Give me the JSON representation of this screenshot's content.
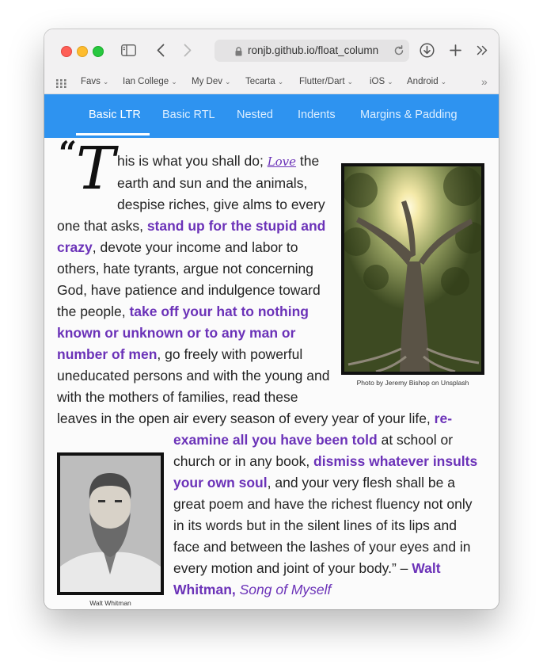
{
  "browser": {
    "url": "ronjb.github.io/float_column",
    "bookmarks": [
      {
        "label": "Favs"
      },
      {
        "label": "Ian College"
      },
      {
        "label": "My Dev"
      },
      {
        "label": "Tecarta"
      },
      {
        "label": "Flutter/Dart"
      },
      {
        "label": "iOS"
      },
      {
        "label": "Android"
      }
    ],
    "icons": [
      "sidebar-icon",
      "chevron-left-icon",
      "chevron-right-icon",
      "lock-icon",
      "reload-icon",
      "download-icon",
      "plus-icon",
      "double-chevron-icon",
      "grid-icon"
    ]
  },
  "nav": {
    "tabs": [
      {
        "label": "Basic LTR",
        "active": true
      },
      {
        "label": "Basic RTL"
      },
      {
        "label": "Nested"
      },
      {
        "label": "Indents"
      },
      {
        "label": "Margins & Padding"
      }
    ],
    "accent": "#2e93f0"
  },
  "article": {
    "open_quote": "“",
    "drop_cap": "T",
    "t1": "his is what you shall do; ",
    "love": "Love",
    "t2": " the earth and sun and the animals, despise riches, give alms to every one that asks, ",
    "h1": "stand up for the stupid and crazy",
    "t3": ", devote your income and labor to others, hate tyrants, argue not concerning God, have patience and indulgence toward the people, ",
    "h2": "take off your hat to nothing known or unknown or to any man or number of men",
    "t4": ", go freely with powerful uneducated persons and with the young and with the mothers of families, read these leaves in the open air every season of every year of your life, ",
    "h3": "re-examine all you have been told",
    "t5": " at school or church or in any book, ",
    "h4": "dismiss whatever insults your own soul",
    "t6": ", and your very flesh shall be a great poem and have the richest fluency not only in its words but in the silent lines of its lips and face and between the lashes of your eyes and in every motion and joint of your body.” – ",
    "cite_author": "Walt Whitman,",
    "cite_work": "Song of Myself",
    "link_color": "#6b32b8"
  },
  "figures": {
    "tree_caption": "Photo by Jeremy Bishop on Unsplash",
    "walt_caption": "Walt Whitman"
  }
}
